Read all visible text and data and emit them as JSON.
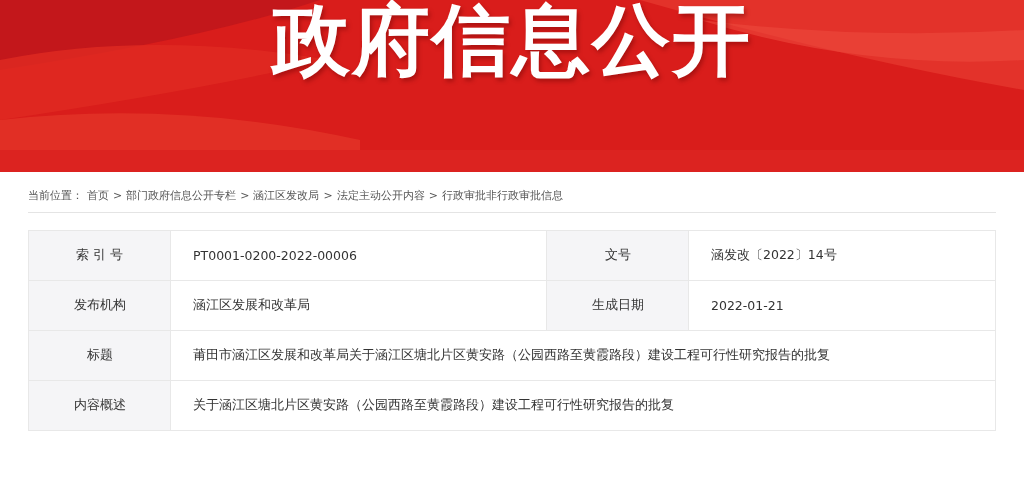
{
  "banner": {
    "title": "政府信息公开"
  },
  "breadcrumb": {
    "label": "当前位置：",
    "separator": ">",
    "items": [
      "首页",
      "部门政府信息公开专栏",
      "涵江区发改局",
      "法定主动公开内容",
      "行政审批非行政审批信息"
    ]
  },
  "info_table": {
    "rows": [
      {
        "fields": [
          {
            "label": "索 引 号",
            "value": "PT0001-0200-2022-00006"
          },
          {
            "label": "文号",
            "value": "涵发改〔2022〕14号"
          }
        ]
      },
      {
        "fields": [
          {
            "label": "发布机构",
            "value": "涵江区发展和改革局"
          },
          {
            "label": "生成日期",
            "value": "2022-01-21"
          }
        ]
      },
      {
        "fields": [
          {
            "label": "标题",
            "value": "莆田市涵江区发展和改革局关于涵江区塘北片区黄安路（公园西路至黄霞路段）建设工程可行性研究报告的批复"
          }
        ]
      },
      {
        "fields": [
          {
            "label": "内容概述",
            "value": "关于涵江区塘北片区黄安路（公园西路至黄霞路段）建设工程可行性研究报告的批复"
          }
        ]
      }
    ]
  }
}
